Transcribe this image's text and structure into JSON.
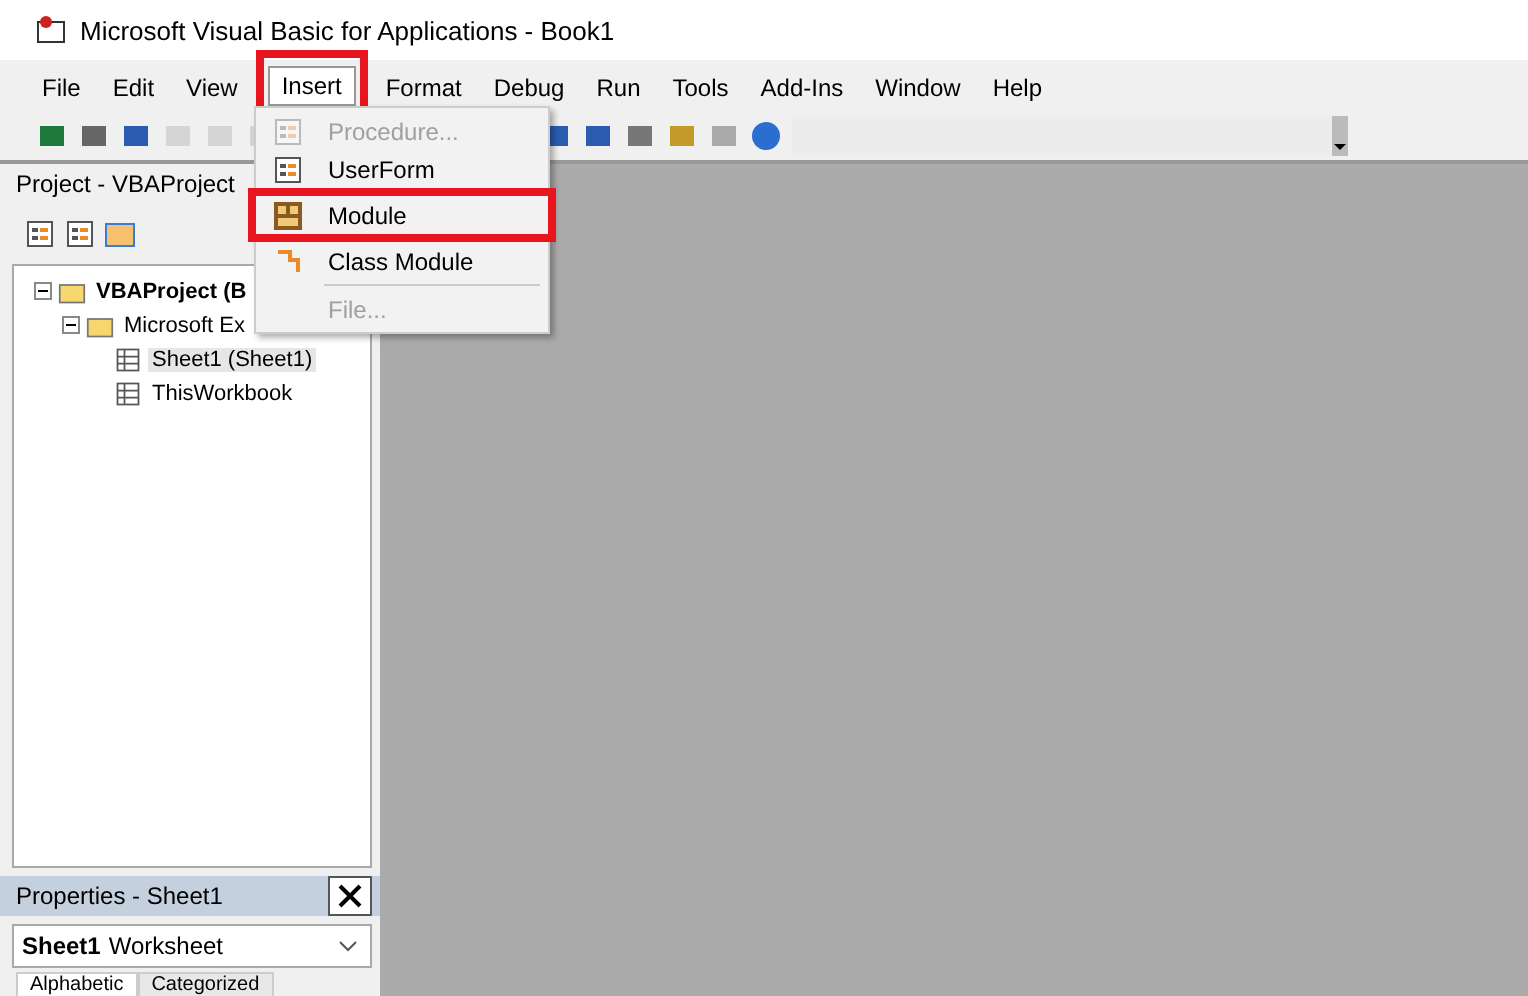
{
  "window": {
    "title": "Microsoft Visual Basic for Applications - Book1"
  },
  "menu_bar": [
    {
      "label": "File",
      "highlighted": false
    },
    {
      "label": "Edit",
      "highlighted": false
    },
    {
      "label": "View",
      "highlighted": false
    },
    {
      "label": "Insert",
      "highlighted": true
    },
    {
      "label": "Format",
      "highlighted": false
    },
    {
      "label": "Debug",
      "highlighted": false
    },
    {
      "label": "Run",
      "highlighted": false
    },
    {
      "label": "Tools",
      "highlighted": false
    },
    {
      "label": "Add-Ins",
      "highlighted": false
    },
    {
      "label": "Window",
      "highlighted": false
    },
    {
      "label": "Help",
      "highlighted": false
    }
  ],
  "insert_menu": [
    {
      "label": "Procedure...",
      "disabled": true,
      "highlighted": false
    },
    {
      "label": "UserForm",
      "disabled": false,
      "highlighted": false
    },
    {
      "label": "Module",
      "disabled": false,
      "highlighted": true
    },
    {
      "label": "Class Module",
      "disabled": false,
      "highlighted": false
    },
    {
      "label": "File...",
      "disabled": true,
      "highlighted": false
    }
  ],
  "project_panel": {
    "title": "Project - VBAProject",
    "tree": [
      {
        "label": "VBAProject (B",
        "bold": true,
        "children": [
          {
            "label": "Microsoft Ex",
            "bold": false,
            "children": [
              {
                "label": "Sheet1 (Sheet1)",
                "bold": false,
                "selected": true
              },
              {
                "label": "ThisWorkbook",
                "bold": false,
                "selected": false
              }
            ]
          }
        ]
      }
    ]
  },
  "properties_panel": {
    "title": "Properties - Sheet1",
    "object": {
      "name": "Sheet1",
      "type": "Worksheet"
    },
    "tabs": [
      {
        "label": "Alphabetic",
        "selected": true
      },
      {
        "label": "Categorized",
        "selected": false
      }
    ]
  }
}
